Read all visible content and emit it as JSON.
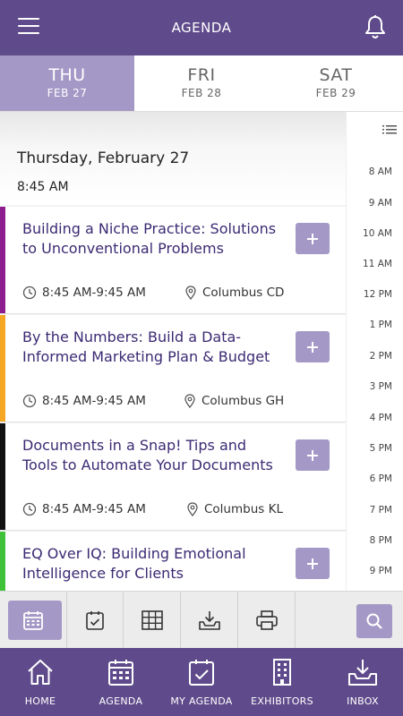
{
  "header": {
    "title": "AGENDA",
    "menu_icon": "hamburger-icon",
    "bell_icon": "bell-icon"
  },
  "days": [
    {
      "name": "THU",
      "date": "FEB 27",
      "active": true
    },
    {
      "name": "FRI",
      "date": "FEB 28",
      "active": false
    },
    {
      "name": "SAT",
      "date": "FEB 29",
      "active": false
    }
  ],
  "schedule": {
    "date_heading": "Thursday, February 27",
    "time_heading": "8:45 AM",
    "sessions": [
      {
        "title": "Building a Niche Practice: Solutions to Unconventional Problems",
        "time": "8:45 AM-9:45 AM",
        "location": "Columbus CD",
        "color": "#8d1d8f"
      },
      {
        "title": "By the Numbers: Build a Data-Informed Marketing Plan & Budget",
        "time": "8:45 AM-9:45 AM",
        "location": "Columbus GH",
        "color": "#f5a623"
      },
      {
        "title": "Documents in a Snap! Tips and Tools to Automate Your Documents",
        "time": "8:45 AM-9:45 AM",
        "location": "Columbus KL",
        "color": "#111111"
      },
      {
        "title": "EQ Over IQ: Building Emotional Intelligence for Clients",
        "time": "",
        "location": "",
        "color": "#3fc23a"
      }
    ]
  },
  "timeline": {
    "hours": [
      "8 AM",
      "9 AM",
      "10 AM",
      "11 AM",
      "12 PM",
      "1 PM",
      "2 PM",
      "3 PM",
      "4 PM",
      "5 PM",
      "6 PM",
      "7 PM",
      "8 PM",
      "9 PM"
    ]
  },
  "toolbar": {
    "items": [
      "calendar-icon",
      "checklist-icon",
      "grid-icon",
      "download-icon",
      "print-icon",
      "search-icon"
    ]
  },
  "tabbar": {
    "items": [
      {
        "label": "HOME",
        "icon": "home-icon"
      },
      {
        "label": "AGENDA",
        "icon": "calendar-icon"
      },
      {
        "label": "MY AGENDA",
        "icon": "calendar-check-icon"
      },
      {
        "label": "EXHIBITORS",
        "icon": "building-icon"
      },
      {
        "label": "INBOX",
        "icon": "inbox-download-icon"
      }
    ]
  },
  "colors": {
    "primary": "#5f4b8b",
    "accent": "#a499c6",
    "title_text": "#3c2a73"
  }
}
